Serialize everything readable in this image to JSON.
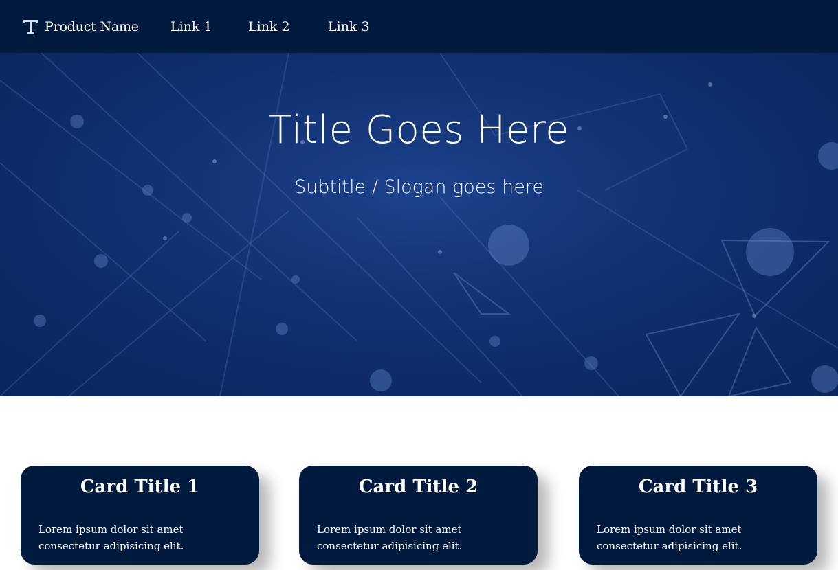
{
  "navbar": {
    "brand": "Product Name",
    "brand_icon": "t-logo-icon",
    "links": [
      "Link 1",
      "Link 2",
      "Link 3"
    ]
  },
  "hero": {
    "title": "Title Goes Here",
    "subtitle": "Subtitle / Slogan goes here"
  },
  "cards": [
    {
      "title": "Card Title 1",
      "text": "Lorem ipsum dolor sit amet consectetur adipisicing elit."
    },
    {
      "title": "Card Title 2",
      "text": "Lorem ipsum dolor sit amet consectetur adipisicing elit."
    },
    {
      "title": "Card Title 3",
      "text": "Lorem ipsum dolor sit amet consectetur adipisicing elit."
    }
  ],
  "colors": {
    "navbar_bg": "#021a3e",
    "hero_bg": "#0f2f6e",
    "card_bg": "#021a3e",
    "page_bg": "#ffffff"
  }
}
